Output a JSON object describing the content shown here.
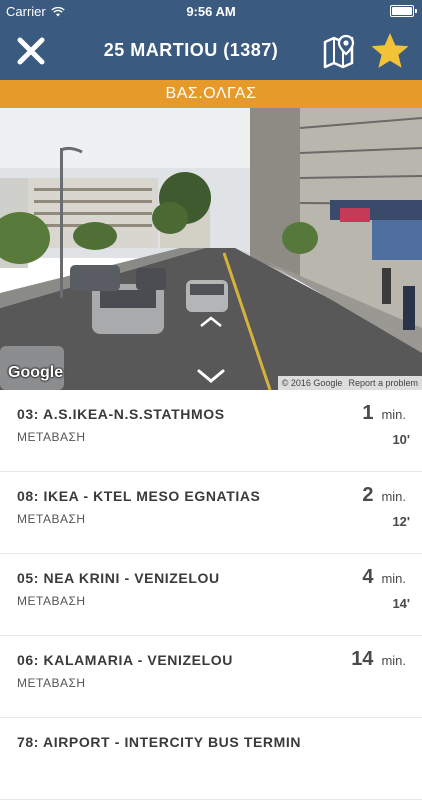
{
  "status_bar": {
    "carrier": "Carrier",
    "time": "9:56 AM"
  },
  "nav": {
    "title": "25 MARTIOU (1387)",
    "close_icon": "close-icon",
    "map_icon": "map-pin-icon",
    "favorite_icon": "star-icon",
    "favorite_color": "#f2c237"
  },
  "stop": {
    "name": "ΒΑΣ.ΟΛΓΑΣ"
  },
  "street_view": {
    "logo": "Google",
    "copyright": "© 2016 Google",
    "report": "Report a problem"
  },
  "routes": [
    {
      "name": "03: A.S.IKEA-N.S.STATHMOS",
      "sub": "ΜΕΤΑΒΑΣΗ",
      "eta": "1",
      "unit": "min.",
      "scheduled": "10'"
    },
    {
      "name": "08: IKEA - KTEL MESO EGNATIAS",
      "sub": "ΜΕΤΑΒΑΣΗ",
      "eta": "2",
      "unit": "min.",
      "scheduled": "12'"
    },
    {
      "name": "05: NEA KRINI - VENIZELOU",
      "sub": "ΜΕΤΑΒΑΣΗ",
      "eta": "4",
      "unit": "min.",
      "scheduled": "14'"
    },
    {
      "name": "06: KALAMARIA - VENIZELOU",
      "sub": "ΜΕΤΑΒΑΣΗ",
      "eta": "14",
      "unit": "min.",
      "scheduled": ""
    },
    {
      "name": "78: AIRPORT - INTERCITY BUS TERMIN",
      "sub": "",
      "eta": "",
      "unit": "",
      "scheduled": ""
    }
  ],
  "colors": {
    "header": "#3a5a80",
    "banner": "#e59a2a"
  }
}
